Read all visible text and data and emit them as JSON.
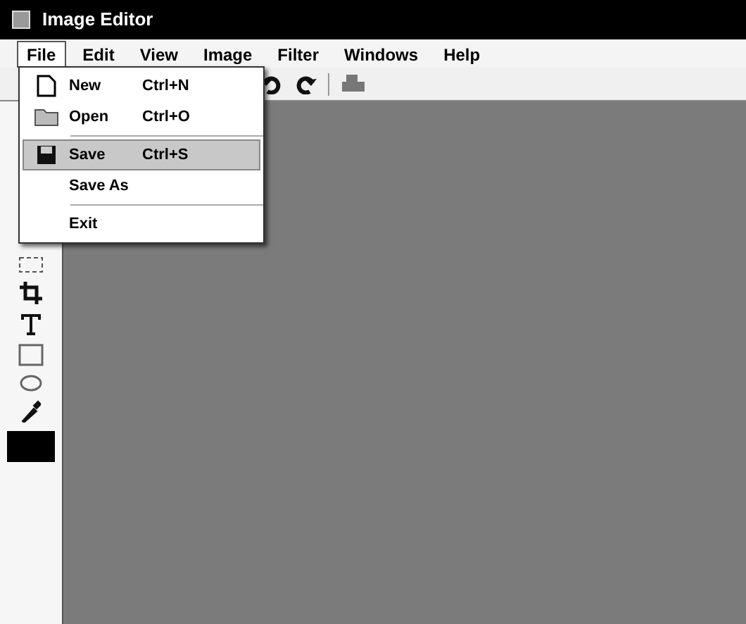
{
  "window": {
    "title": "Image Editor"
  },
  "menu_bar": [
    {
      "label": "File",
      "selected": true
    },
    {
      "label": "Edit",
      "selected": false
    },
    {
      "label": "View",
      "selected": false
    },
    {
      "label": "Image",
      "selected": false
    },
    {
      "label": "Filter",
      "selected": false
    },
    {
      "label": "Windows",
      "selected": false
    },
    {
      "label": "Help",
      "selected": false
    }
  ],
  "file_menu": [
    {
      "label": "New",
      "shortcut": "Ctrl+N",
      "kind": "new",
      "separator_before": false,
      "selected": false
    },
    {
      "label": "Open",
      "shortcut": "Ctrl+O",
      "kind": "open",
      "separator_before": false,
      "selected": false
    },
    {
      "label": "Save",
      "shortcut": "Ctrl+S",
      "kind": "save",
      "separator_before": true,
      "selected": true
    },
    {
      "label": "Save As",
      "kind": "plain",
      "separator_before": false,
      "selected": false
    },
    {
      "label": "Exit",
      "kind": "plain",
      "separator_before": true,
      "selected": false
    }
  ]
}
